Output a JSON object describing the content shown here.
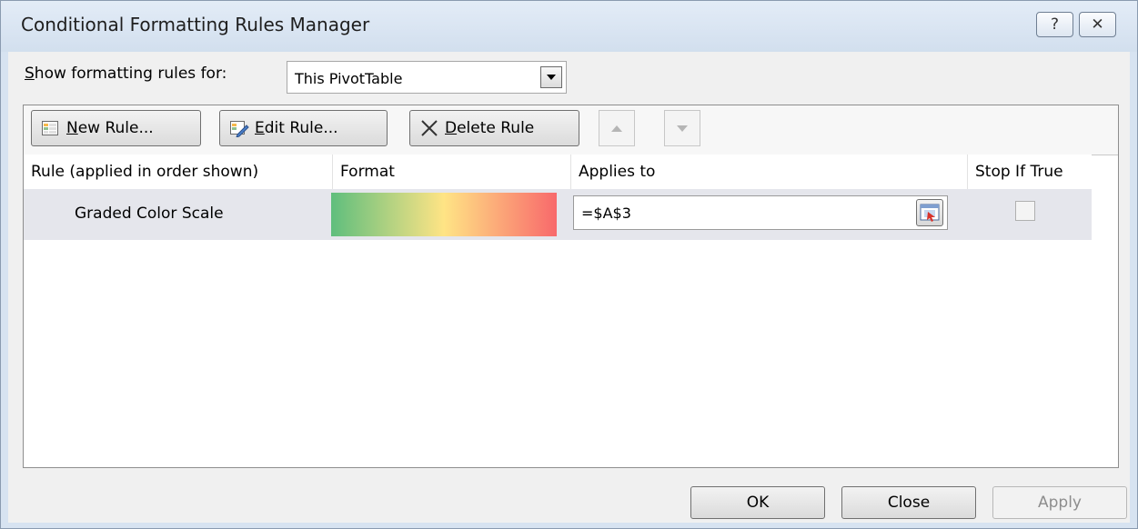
{
  "window": {
    "title": "Conditional Formatting Rules Manager",
    "help_glyph": "?",
    "close_glyph": "✕"
  },
  "show_rules": {
    "label_mnemonic": "S",
    "label_rest": "how formatting rules for:",
    "selected": "This PivotTable"
  },
  "toolbar": {
    "new_rule": {
      "mnemonic": "N",
      "rest": "ew Rule..."
    },
    "edit_rule": {
      "mnemonic": "E",
      "rest": "dit Rule..."
    },
    "delete_rule": {
      "mnemonic": "D",
      "rest": "elete Rule"
    }
  },
  "table": {
    "columns": [
      "Rule (applied in order shown)",
      "Format",
      "Applies to",
      "Stop If True"
    ],
    "rows": [
      {
        "rule": "Graded Color Scale",
        "applies_to": "=$A$3",
        "stop_if_true": false,
        "format_colors": [
          "#5fbe7d",
          "#ffe485",
          "#f8696b"
        ]
      }
    ]
  },
  "footer": {
    "ok": "OK",
    "close": "Close",
    "apply": "Apply"
  }
}
